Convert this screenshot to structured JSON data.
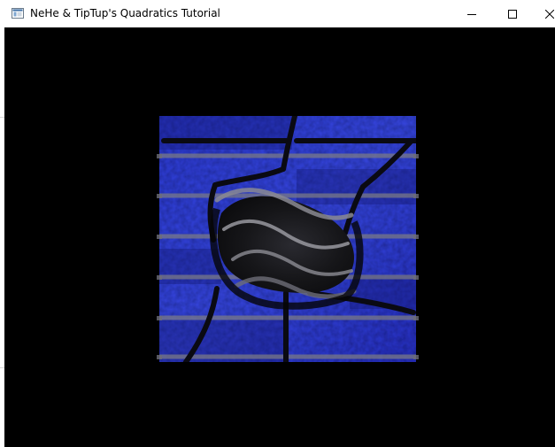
{
  "window": {
    "title": "NeHe & TipTup's Quadratics Tutorial",
    "app_icon": "window-app-icon",
    "controls": {
      "minimize_icon": "minimize-icon",
      "maximize_icon": "maximize-icon",
      "close_icon": "close-icon"
    }
  },
  "viewport": {
    "background": "#000000",
    "object": {
      "texture_colors": {
        "blue_light": "#3a4adf",
        "blue_dark": "#1c22a8",
        "stripe": "#6d6d78",
        "center_dark": "#1b1b1f",
        "center_light": "#9a9aa0"
      }
    }
  }
}
